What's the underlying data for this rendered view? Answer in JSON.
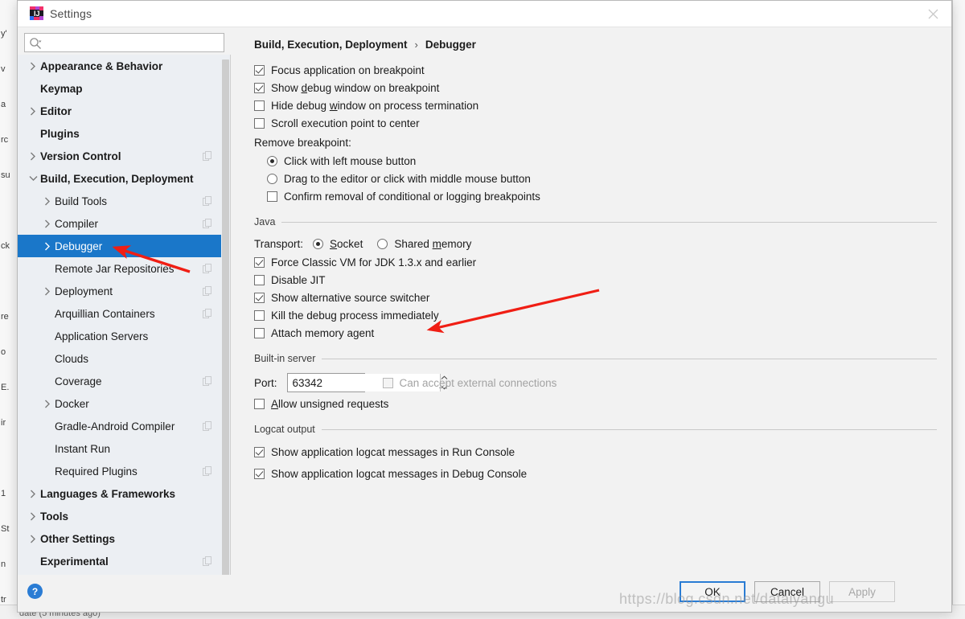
{
  "window": {
    "title": "Settings",
    "logo_icon": "intellij-idea-logo",
    "close_icon": "close-icon"
  },
  "search": {
    "value": "",
    "placeholder": "",
    "icon": "search-icon"
  },
  "sidebar": {
    "scrollbar": "vertical-scrollbar",
    "items": [
      {
        "label": "Appearance & Behavior",
        "level": 0,
        "bold": true,
        "arrow": "collapsed",
        "selected": false,
        "copy": false
      },
      {
        "label": "Keymap",
        "level": 0,
        "bold": true,
        "arrow": "none",
        "selected": false,
        "copy": false
      },
      {
        "label": "Editor",
        "level": 0,
        "bold": true,
        "arrow": "collapsed",
        "selected": false,
        "copy": false
      },
      {
        "label": "Plugins",
        "level": 0,
        "bold": true,
        "arrow": "none",
        "selected": false,
        "copy": false
      },
      {
        "label": "Version Control",
        "level": 0,
        "bold": true,
        "arrow": "collapsed",
        "selected": false,
        "copy": true
      },
      {
        "label": "Build, Execution, Deployment",
        "level": 0,
        "bold": true,
        "arrow": "expanded",
        "selected": false,
        "copy": false
      },
      {
        "label": "Build Tools",
        "level": 1,
        "bold": false,
        "arrow": "collapsed",
        "selected": false,
        "copy": true
      },
      {
        "label": "Compiler",
        "level": 1,
        "bold": false,
        "arrow": "collapsed",
        "selected": false,
        "copy": true
      },
      {
        "label": "Debugger",
        "level": 1,
        "bold": false,
        "arrow": "collapsed",
        "selected": true,
        "copy": false
      },
      {
        "label": "Remote Jar Repositories",
        "level": 1,
        "bold": false,
        "arrow": "none",
        "selected": false,
        "copy": true
      },
      {
        "label": "Deployment",
        "level": 1,
        "bold": false,
        "arrow": "collapsed",
        "selected": false,
        "copy": true
      },
      {
        "label": "Arquillian Containers",
        "level": 1,
        "bold": false,
        "arrow": "none",
        "selected": false,
        "copy": true
      },
      {
        "label": "Application Servers",
        "level": 1,
        "bold": false,
        "arrow": "none",
        "selected": false,
        "copy": false
      },
      {
        "label": "Clouds",
        "level": 1,
        "bold": false,
        "arrow": "none",
        "selected": false,
        "copy": false
      },
      {
        "label": "Coverage",
        "level": 1,
        "bold": false,
        "arrow": "none",
        "selected": false,
        "copy": true
      },
      {
        "label": "Docker",
        "level": 1,
        "bold": false,
        "arrow": "collapsed",
        "selected": false,
        "copy": false
      },
      {
        "label": "Gradle-Android Compiler",
        "level": 1,
        "bold": false,
        "arrow": "none",
        "selected": false,
        "copy": true
      },
      {
        "label": "Instant Run",
        "level": 1,
        "bold": false,
        "arrow": "none",
        "selected": false,
        "copy": false
      },
      {
        "label": "Required Plugins",
        "level": 1,
        "bold": false,
        "arrow": "none",
        "selected": false,
        "copy": true
      },
      {
        "label": "Languages & Frameworks",
        "level": 0,
        "bold": true,
        "arrow": "collapsed",
        "selected": false,
        "copy": false
      },
      {
        "label": "Tools",
        "level": 0,
        "bold": true,
        "arrow": "collapsed",
        "selected": false,
        "copy": false
      },
      {
        "label": "Other Settings",
        "level": 0,
        "bold": true,
        "arrow": "collapsed",
        "selected": false,
        "copy": false
      },
      {
        "label": "Experimental",
        "level": 0,
        "bold": true,
        "arrow": "none",
        "selected": false,
        "copy": true
      }
    ]
  },
  "breadcrumb": {
    "parent": "Build, Execution, Deployment",
    "separator": "›",
    "current": "Debugger"
  },
  "main": {
    "top_checkboxes": [
      {
        "label": "Focus application on breakpoint",
        "checked": true,
        "mnemonic": ""
      },
      {
        "label": "Show debug window on breakpoint",
        "checked": true,
        "mnemonic": "d"
      },
      {
        "label": "Hide debug window on process termination",
        "checked": false,
        "mnemonic": "w"
      },
      {
        "label": "Scroll execution point to center",
        "checked": false,
        "mnemonic": ""
      }
    ],
    "remove_breakpoint": {
      "label": "Remove breakpoint:",
      "options": [
        {
          "label": "Click with left mouse button",
          "selected": true
        },
        {
          "label": "Drag to the editor or click with middle mouse button",
          "selected": false
        }
      ],
      "confirm_checkbox": {
        "label": "Confirm removal of conditional or logging breakpoints",
        "checked": false
      }
    },
    "java_group": {
      "title": "Java",
      "transport_label": "Transport:",
      "transport_options": [
        {
          "label": "Socket",
          "selected": true,
          "mnemonic": "S"
        },
        {
          "label": "Shared memory",
          "selected": false,
          "mnemonic": "m"
        }
      ],
      "checkboxes": [
        {
          "label": "Force Classic VM for JDK 1.3.x and earlier",
          "checked": true
        },
        {
          "label": "Disable JIT",
          "checked": false
        },
        {
          "label": "Show alternative source switcher",
          "checked": true
        },
        {
          "label": "Kill the debug process immediately",
          "checked": false
        },
        {
          "label": "Attach memory agent",
          "checked": false
        }
      ]
    },
    "builtin_server": {
      "title": "Built-in server",
      "port_label": "Port:",
      "port_value": "63342",
      "spinner_up_icon": "chevron-up-icon",
      "spinner_down_icon": "chevron-down-icon",
      "external_checkbox": {
        "label": "Can accept external connections",
        "checked": false,
        "disabled": true,
        "mnemonic": "e"
      },
      "unsigned_checkbox": {
        "label": "Allow unsigned requests",
        "checked": false,
        "mnemonic": "A"
      }
    },
    "logcat": {
      "title": "Logcat output",
      "checkboxes": [
        {
          "label": "Show application logcat messages in Run Console",
          "checked": true
        },
        {
          "label": "Show application logcat messages in Debug Console",
          "checked": true
        }
      ]
    }
  },
  "footer": {
    "help_label": "?",
    "ok_label": "OK",
    "cancel_label": "Cancel",
    "apply_label": "Apply"
  },
  "watermark": {
    "text": "https://blog.csdn.net/dataiyangu"
  },
  "background": {
    "left_fragments": [
      "y'",
      "v",
      "a",
      "rc",
      "su",
      "",
      "ck",
      "",
      "re",
      "o",
      "E.",
      "ir",
      "",
      "1",
      "St",
      "n",
      "tr"
    ],
    "bottom_text": "date (5 minutes ago)"
  },
  "colors": {
    "accent": "#1a77c9",
    "selection": "#1a77c9",
    "annotation": "#f01e14",
    "help": "#2a7cd4",
    "sidebar_bg": "#eceff3",
    "panel_bg": "#f2f2f2"
  }
}
